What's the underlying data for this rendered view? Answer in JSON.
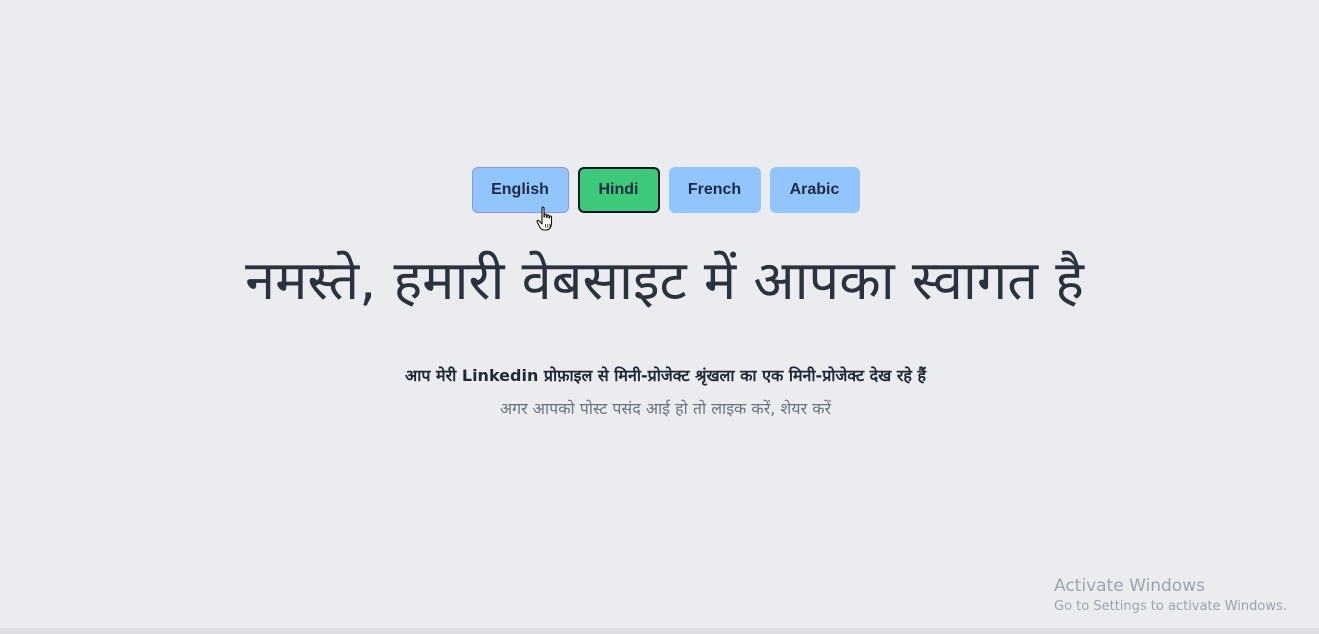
{
  "languages": {
    "english": "English",
    "hindi": "Hindi",
    "french": "French",
    "arabic": "Arabic",
    "active": "Hindi"
  },
  "content": {
    "headline": "नमस्ते, हमारी वेबसाइट में आपका स्वागत है",
    "subline_1": "आप मेरी Linkedin प्रोफ़ाइल से मिनी-प्रोजेक्ट श्रृंखला का एक मिनी-प्रोजेक्ट देख रहे हैं",
    "subline_2": "अगर आपको पोस्ट पसंद आई हो तो लाइक करें, शेयर करें"
  },
  "watermark": {
    "title": "Activate Windows",
    "subtitle": "Go to Settings to activate Windows."
  },
  "colors": {
    "background": "#ebecf0",
    "button_default": "#93c5fd",
    "button_active": "#3ec97a",
    "text_dark": "#2a3240",
    "text_muted": "#6b7280"
  },
  "icons": {
    "cursor": "hand-pointer-icon"
  }
}
